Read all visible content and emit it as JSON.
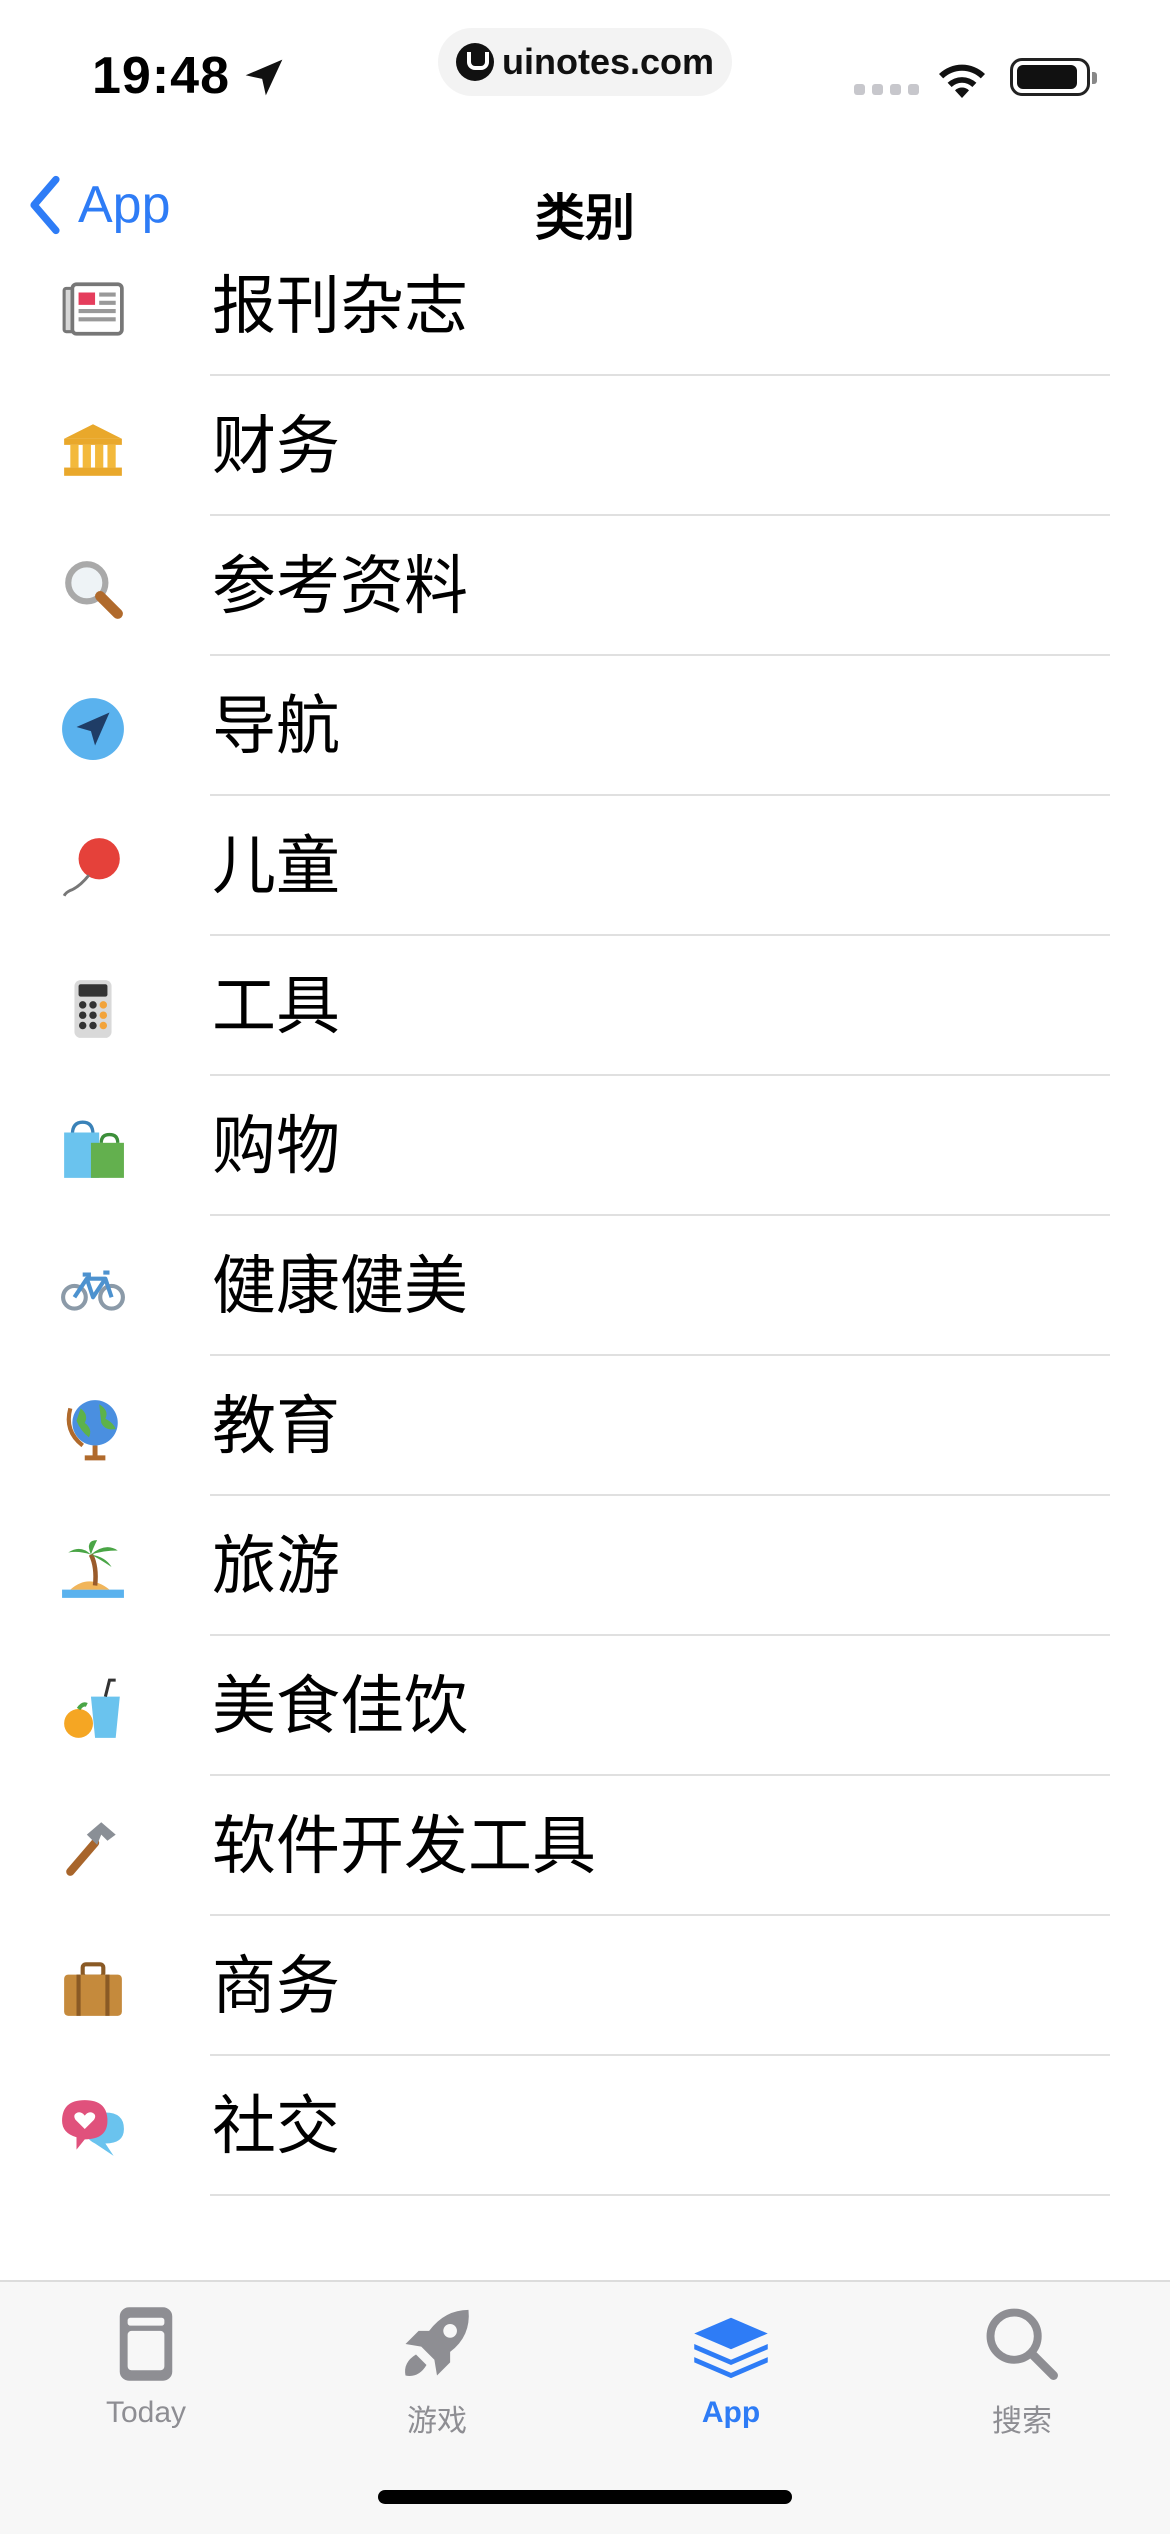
{
  "status_bar": {
    "time": "19:48",
    "url": "uinotes.com"
  },
  "nav": {
    "back_label": "App",
    "title": "类别"
  },
  "categories": [
    {
      "label": "报刊杂志",
      "icon": "newspaper-icon"
    },
    {
      "label": "财务",
      "icon": "bank-icon"
    },
    {
      "label": "参考资料",
      "icon": "magnifier-icon"
    },
    {
      "label": "导航",
      "icon": "navigation-icon"
    },
    {
      "label": "儿童",
      "icon": "balloon-icon"
    },
    {
      "label": "工具",
      "icon": "calculator-icon"
    },
    {
      "label": "购物",
      "icon": "shopping-bags-icon"
    },
    {
      "label": "健康健美",
      "icon": "bicycle-icon"
    },
    {
      "label": "教育",
      "icon": "globe-icon"
    },
    {
      "label": "旅游",
      "icon": "palm-island-icon"
    },
    {
      "label": "美食佳饮",
      "icon": "drink-icon"
    },
    {
      "label": "软件开发工具",
      "icon": "hammer-icon"
    },
    {
      "label": "商务",
      "icon": "briefcase-icon"
    },
    {
      "label": "社交",
      "icon": "chat-heart-icon"
    }
  ],
  "tabs": [
    {
      "label": "Today",
      "icon": "today-icon",
      "active": false
    },
    {
      "label": "游戏",
      "icon": "rocket-icon",
      "active": false
    },
    {
      "label": "App",
      "icon": "app-stack-icon",
      "active": true
    },
    {
      "label": "搜索",
      "icon": "search-icon",
      "active": false
    }
  ],
  "colors": {
    "accent": "#2e7cf6",
    "inactive_tab": "#8e8e93",
    "separator": "#e0e0e0"
  }
}
